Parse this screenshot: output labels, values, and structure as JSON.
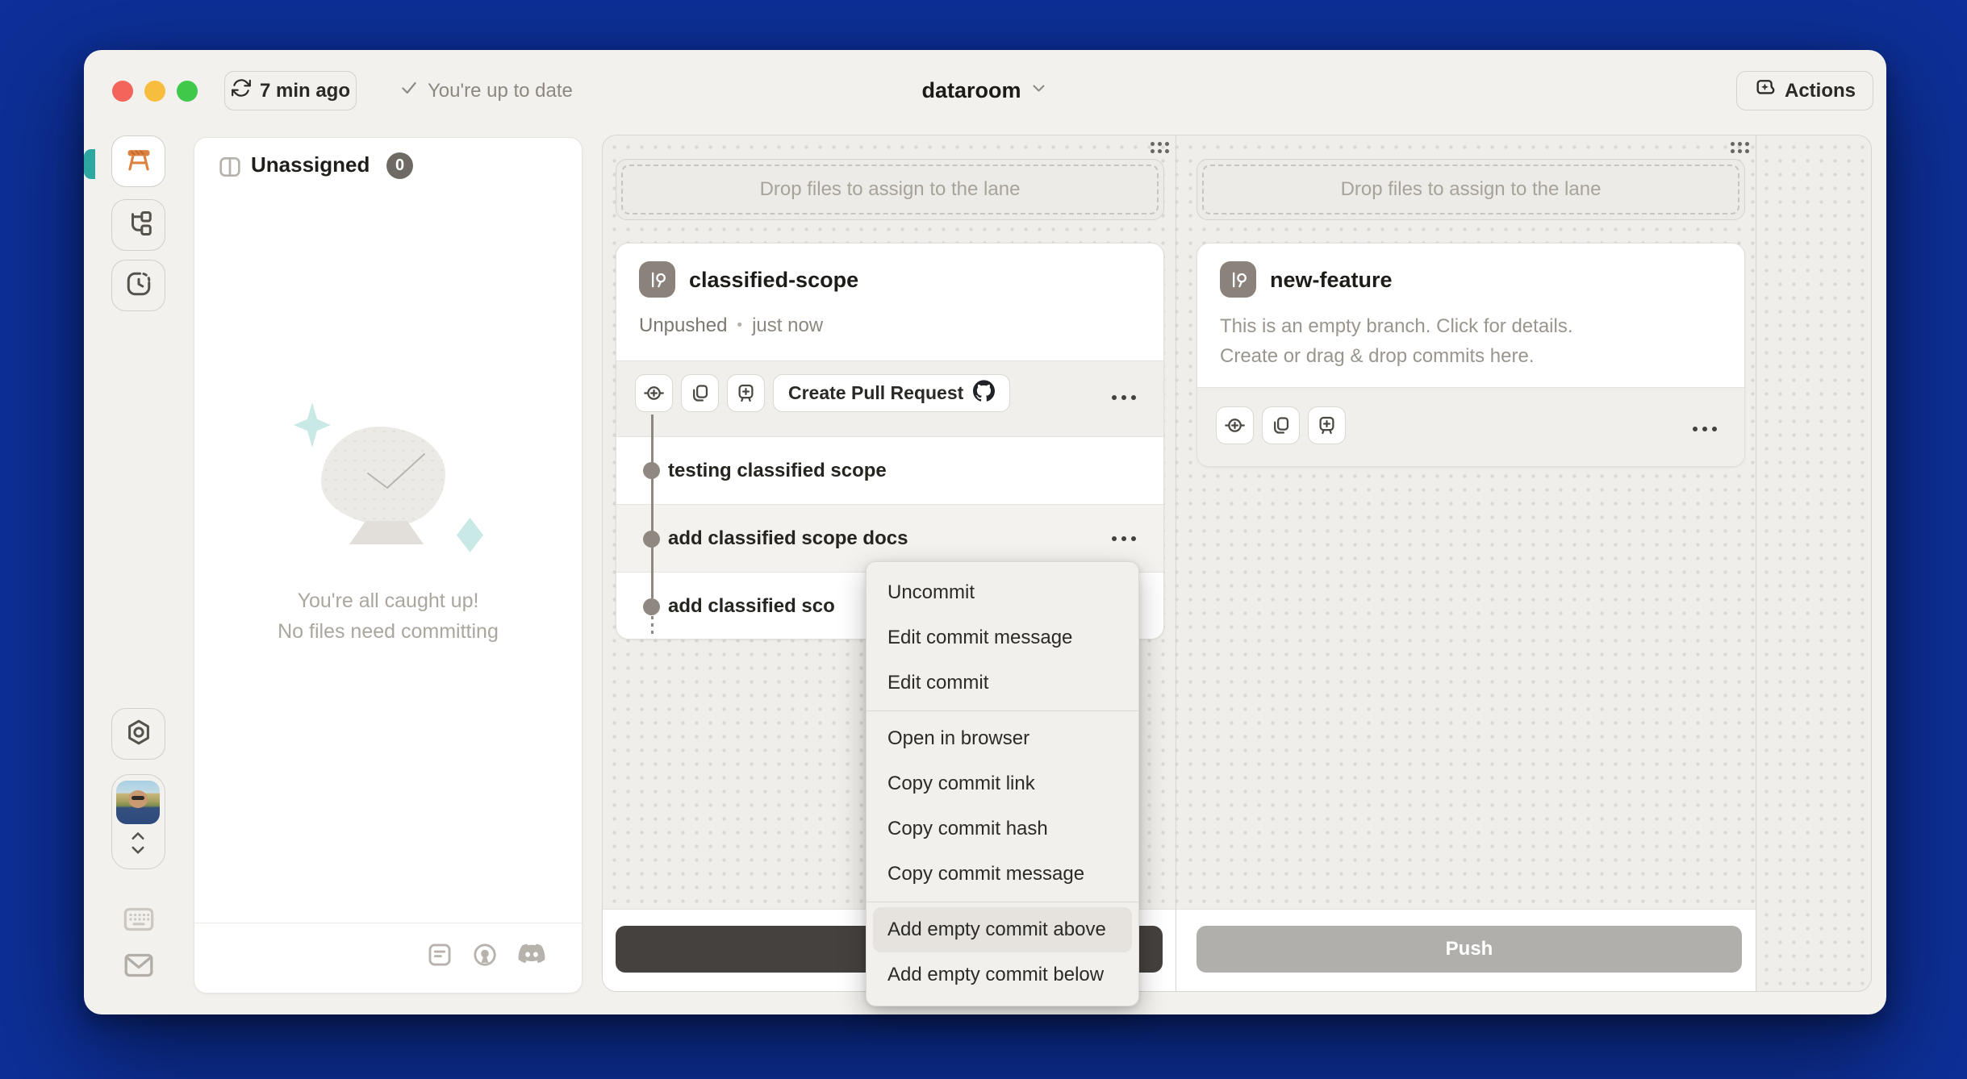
{
  "header": {
    "sync_time": "7 min ago",
    "up_to_date": "You're up to date",
    "project": "dataroom",
    "actions": "Actions"
  },
  "unassigned": {
    "title": "Unassigned",
    "count": "0",
    "empty_line1": "You're all caught up!",
    "empty_line2": "No files need committing"
  },
  "lane1": {
    "drop_hint": "Drop files to assign to the lane",
    "branch": "classified-scope",
    "status": "Unpushed",
    "dot": "•",
    "time": "just now",
    "pr_button": "Create Pull Request",
    "commits": [
      "testing classified scope",
      "add classified scope docs",
      "add classified sco"
    ]
  },
  "lane2": {
    "drop_hint": "Drop files to assign to the lane",
    "branch": "new-feature",
    "desc1": "This is an empty branch. Click for details.",
    "desc2": "Create or drag & drop commits here.",
    "push": "Push"
  },
  "menu": {
    "group1": [
      "Uncommit",
      "Edit commit message",
      "Edit commit"
    ],
    "group2": [
      "Open in browser",
      "Copy commit link",
      "Copy commit hash",
      "Copy commit message"
    ],
    "group3": [
      "Add empty commit above",
      "Add empty commit below"
    ]
  },
  "icons": {
    "sync": "refresh-arrows",
    "check": "checkmark",
    "chevron_down": "chevron-down",
    "actions": "sparkle-box",
    "workspace": "butler-stool",
    "branches": "branch-graph",
    "history": "clock-frame",
    "settings": "hex-nut",
    "keyboard": "keyboard",
    "mail": "envelope",
    "github": "github-octocat",
    "discord": "discord",
    "open_source": "open-source-keyhole",
    "notes": "note-square"
  },
  "colors": {
    "accent_orange": "#dd8140",
    "teal_tab": "#2ea7a1",
    "traffic_red": "#f5645a",
    "traffic_yellow": "#f6bd3f",
    "traffic_green": "#3ec94b",
    "push_dark": "#45413e",
    "push_gray": "#b1afac",
    "menu_highlight": "#e6e3de",
    "commit_dot": "#8f8881"
  }
}
